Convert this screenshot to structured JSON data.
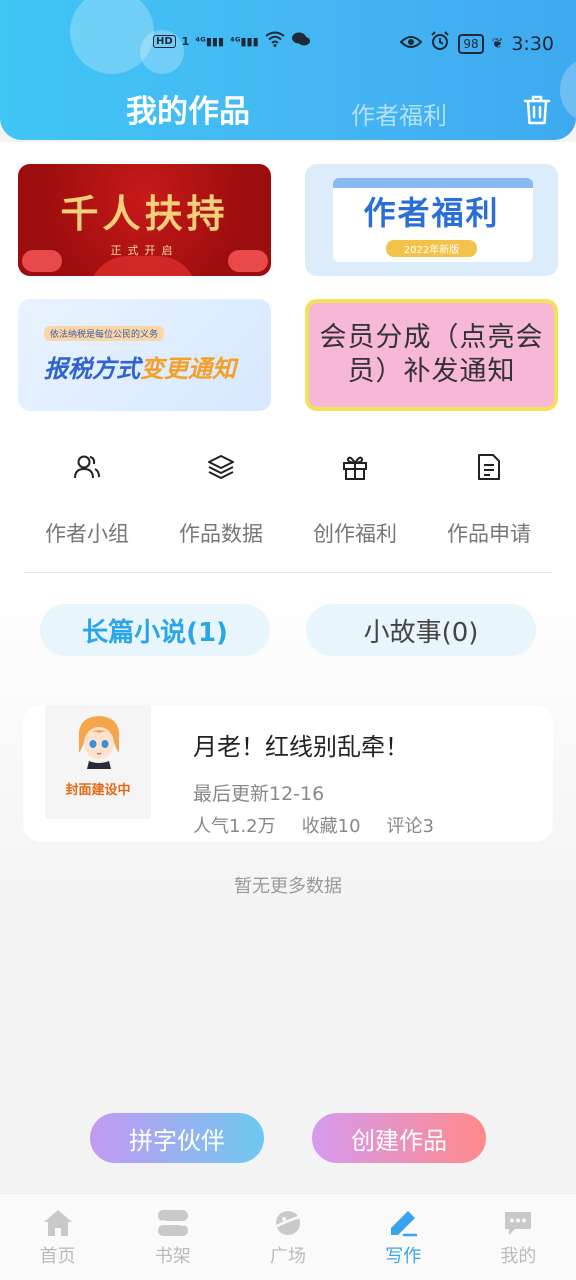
{
  "status_bar": {
    "left_icons": [
      "hd-icon",
      "sim1-icon",
      "signal-4g-icon",
      "signal-4g-icon",
      "wifi-icon",
      "wechat-icon"
    ],
    "battery": "98",
    "time": "3:30"
  },
  "header": {
    "tab_active": "我的作品",
    "tab_inactive": "作者福利"
  },
  "banners": {
    "b1_title": "千人扶持",
    "b1_sub": "正式开启",
    "b2_title": "作者福利",
    "b2_sub": "2022年新版",
    "b3_sub": "依法纳税是每位公民的义务",
    "b3_title_a": "报税方式",
    "b3_title_b": "变更通知",
    "b4_line1": "会员分成（点亮会",
    "b4_line2": "员）补发通知"
  },
  "quick_links": [
    {
      "label": "作者小组",
      "icon": "group-icon"
    },
    {
      "label": "作品数据",
      "icon": "layers-icon"
    },
    {
      "label": "创作福利",
      "icon": "gift-icon"
    },
    {
      "label": "作品申请",
      "icon": "document-icon"
    }
  ],
  "filters": {
    "long_novel": "长篇小说(1)",
    "short_story": "小故事(0)"
  },
  "works": [
    {
      "cover_label": "封面建设中",
      "title": "月老！红线别乱牵！",
      "updated": "最后更新12-16",
      "popularity": "人气1.2万",
      "favorites": "收藏10",
      "comments": "评论3"
    }
  ],
  "empty_more": "暂无更多数据",
  "actions": {
    "partner": "拼字伙伴",
    "create": "创建作品"
  },
  "tabbar": [
    {
      "label": "首页",
      "icon": "home-icon"
    },
    {
      "label": "书架",
      "icon": "bookshelf-icon"
    },
    {
      "label": "广场",
      "icon": "planet-icon"
    },
    {
      "label": "写作",
      "icon": "pen-icon"
    },
    {
      "label": "我的",
      "icon": "chat-bubble-icon"
    }
  ],
  "colors": {
    "accent": "#3aa3ee",
    "header_gradient_start": "#3fc6f5",
    "header_gradient_end": "#3ea9f0"
  }
}
